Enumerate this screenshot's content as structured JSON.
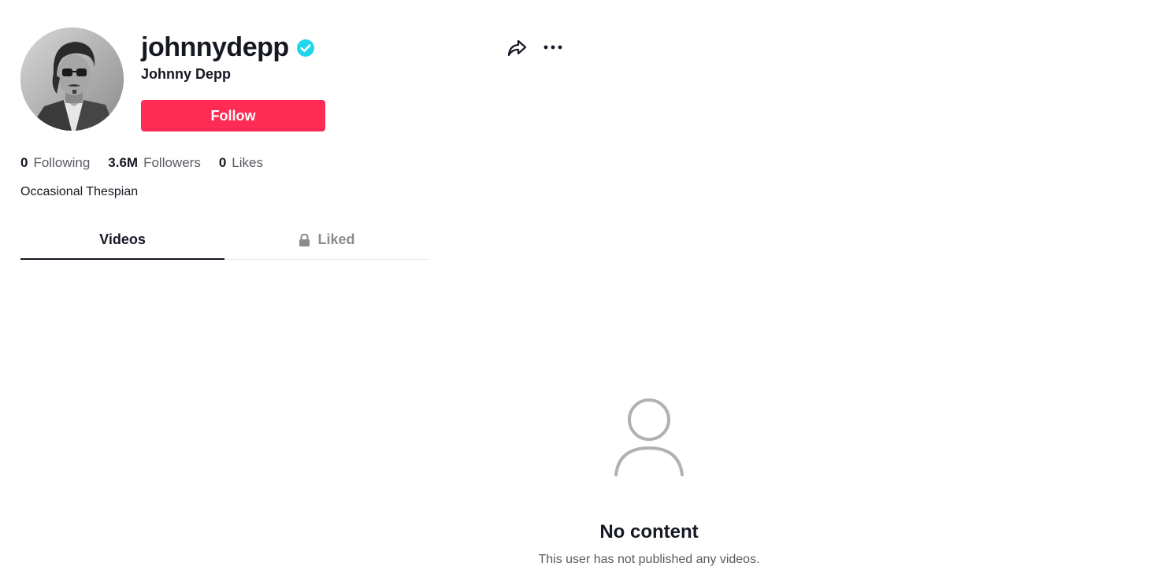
{
  "profile": {
    "username": "johnnydepp",
    "display_name": "Johnny Depp",
    "verified": true,
    "follow_label": "Follow",
    "bio": "Occasional Thespian"
  },
  "stats": [
    {
      "value": "0",
      "label": "Following"
    },
    {
      "value": "3.6M",
      "label": "Followers"
    },
    {
      "value": "0",
      "label": "Likes"
    }
  ],
  "tabs": [
    {
      "label": "Videos",
      "active": true,
      "icon": ""
    },
    {
      "label": "Liked",
      "active": false,
      "icon": "lock-icon"
    }
  ],
  "empty_state": {
    "icon": "user-outline-icon",
    "title": "No content",
    "description": "This user has not published any videos."
  },
  "header_actions": [
    "share-icon",
    "more-icon"
  ],
  "colors": {
    "accent": "#fe2c55",
    "verified": "#20d5ec",
    "text_primary": "#161823",
    "text_secondary": "#5a5b63"
  }
}
